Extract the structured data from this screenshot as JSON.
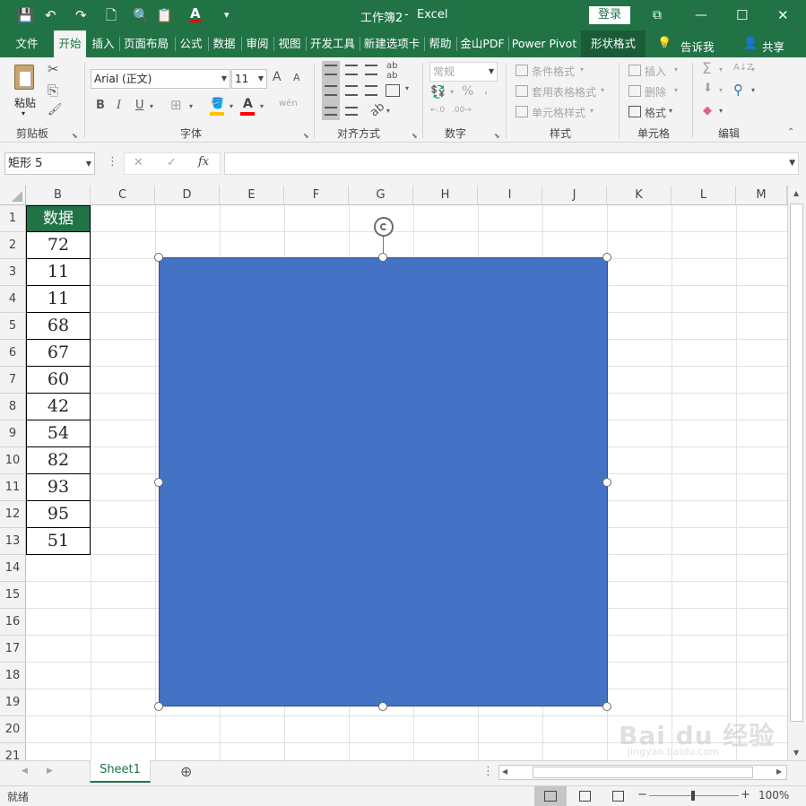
{
  "window": {
    "doc_title": "工作簿2",
    "app_name": "Excel",
    "login_label": "登录",
    "qat": {
      "save_icon": "💾",
      "undo_icon": "↶",
      "redo_icon": "↷",
      "new_icon": "🗋",
      "preview_icon": "🔍",
      "paste_icon": "📋",
      "font_color_icon": "A",
      "more_icon": "▾"
    },
    "controls": {
      "ribbon_opts_icon": "⧉",
      "minimize_icon": "—",
      "maximize_icon": "☐",
      "close_icon": "✕"
    }
  },
  "tabs": [
    {
      "label": "文件"
    },
    {
      "label": "开始"
    },
    {
      "label": "插入"
    },
    {
      "label": "页面布局"
    },
    {
      "label": "公式"
    },
    {
      "label": "数据"
    },
    {
      "label": "审阅"
    },
    {
      "label": "视图"
    },
    {
      "label": "开发工具"
    },
    {
      "label": "新建选项卡"
    },
    {
      "label": "帮助"
    },
    {
      "label": "金山PDF"
    },
    {
      "label": "Power Pivot"
    },
    {
      "label": "形状格式"
    }
  ],
  "tell_me": {
    "label": "告诉我",
    "icon": "💡"
  },
  "share": {
    "label": "共享",
    "icon": "👤"
  },
  "ribbon": {
    "clipboard": {
      "group": "剪贴板",
      "paste_label": "粘贴",
      "cut_icon": "✂",
      "copy_icon": "⎘",
      "painter_icon": "🖌"
    },
    "font": {
      "group": "字体",
      "font_name": "Arial (正文)",
      "font_size": "11",
      "grow_label": "A",
      "shrink_label": "A",
      "bold": "B",
      "italic": "I",
      "underline": "U",
      "border_icon": "⊞",
      "fill_icon": "🪣",
      "font_color_label": "A",
      "phonetic_label": "wén"
    },
    "align": {
      "group": "对齐方式",
      "wrap_label": "ab",
      "orient_label": "ab"
    },
    "number": {
      "group": "数字",
      "format": "常规",
      "currency_icon": "💱",
      "percent_label": "%",
      "comma_label": ",",
      "inc_label": "←.0",
      "dec_label": ".00→"
    },
    "styles": {
      "group": "样式",
      "cond_label": "条件格式",
      "table_label": "套用表格格式",
      "cell_label": "单元格样式"
    },
    "cells": {
      "group": "单元格",
      "insert_label": "插入",
      "delete_label": "删除",
      "format_label": "格式"
    },
    "editing": {
      "group": "编辑",
      "sum_icon": "Σ",
      "fill_icon": "⬇",
      "clear_icon": "◆",
      "sort_icon": "A↓Z",
      "find_icon": "⚲"
    }
  },
  "formula_bar": {
    "name_box": "矩形 5",
    "cancel_icon": "✕",
    "enter_icon": "✓",
    "fx_label": "fx",
    "formula": ""
  },
  "columns": [
    "B",
    "C",
    "D",
    "E",
    "F",
    "G",
    "H",
    "I",
    "J",
    "K",
    "L",
    "M"
  ],
  "rows": [
    "1",
    "2",
    "3",
    "4",
    "5",
    "6",
    "7",
    "8",
    "9",
    "10",
    "11",
    "12",
    "13",
    "14",
    "15",
    "16",
    "17",
    "18",
    "19",
    "20",
    "21"
  ],
  "data_table": {
    "header": "数据",
    "values": [
      "72",
      "11",
      "11",
      "68",
      "67",
      "60",
      "42",
      "54",
      "82",
      "93",
      "95",
      "51"
    ]
  },
  "shape": {
    "name": "矩形 5",
    "fill": "#4472c4"
  },
  "colors": {
    "excel_green": "#217346",
    "header_fill": "#217346",
    "shape_blue": "#4472c4"
  },
  "sheets": [
    {
      "label": "Sheet1"
    }
  ],
  "add_sheet_icon": "⊕",
  "status": {
    "ready": "就绪",
    "zoom": "100%",
    "zoom_out": "−",
    "zoom_in": "+"
  },
  "watermark": {
    "brand": "Bai du 经验",
    "url": "jingyan.baidu.com"
  }
}
